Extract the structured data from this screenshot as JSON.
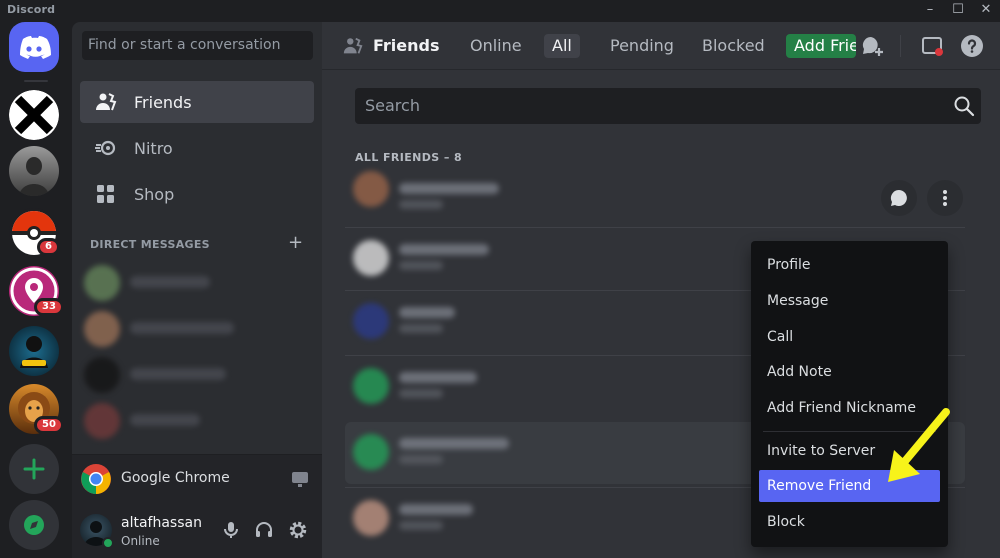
{
  "window": {
    "title": "Discord",
    "minimize": "–",
    "maximize": "☐",
    "close": "✕"
  },
  "servers": {
    "badges": [
      "6",
      "33",
      "50"
    ]
  },
  "sidebar": {
    "search_placeholder": "Find or start a conversation",
    "nav": [
      {
        "label": "Friends",
        "icon": "friends-icon",
        "active": true
      },
      {
        "label": "Nitro",
        "icon": "nitro-icon"
      },
      {
        "label": "Shop",
        "icon": "shop-icon"
      }
    ],
    "dm_header": "DIRECT MESSAGES",
    "dm_add": "+",
    "activity": {
      "app": "Google Chrome"
    },
    "user": {
      "name": "altafhassan",
      "status": "Online"
    }
  },
  "topbar": {
    "title": "Friends",
    "tabs": [
      {
        "label": "Online"
      },
      {
        "label": "All",
        "active": true
      },
      {
        "label": "Pending"
      },
      {
        "label": "Blocked"
      },
      {
        "label": "Add Friend",
        "primary": true
      }
    ]
  },
  "friends": {
    "search_placeholder": "Search",
    "count_label": "ALL FRIENDS – 8"
  },
  "context_menu": {
    "items": [
      "Profile",
      "Message",
      "Call",
      "Add Note",
      "Add Friend Nickname",
      "Invite to Server",
      "Remove Friend",
      "Block"
    ],
    "highlighted": "Remove Friend"
  },
  "colors": {
    "blurple": "#5865f2",
    "green": "#248046",
    "red": "#da373c",
    "annotation_arrow": "#f7f31a"
  }
}
